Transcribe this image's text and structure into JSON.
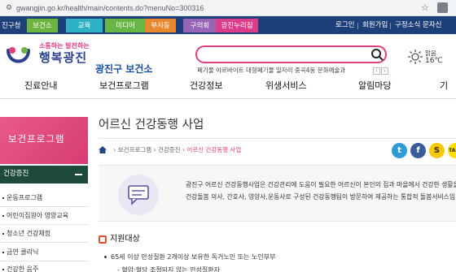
{
  "browser": {
    "url": "gwangjin.go.kr/health/main/contents.do?menuNo=300316"
  },
  "top_nav": {
    "items": [
      "진구청",
      "보건소",
      "교육",
      "미디어",
      "부사동",
      "구의회",
      "광진누리집"
    ],
    "right": [
      "로그인",
      "회원가입",
      "구정소식 문자신"
    ]
  },
  "header": {
    "slogan_top": "소통하는 발전하는",
    "slogan_bottom": "행복광진",
    "site_name": "광진구 보건소",
    "search_placeholder": "",
    "keywords": "폐기물  아르바이트  대형폐기물  일자리  중곡4동  문화예술과",
    "kw_prev": "‹",
    "kw_next": "›",
    "weather_label": "맑음",
    "weather_temp": "16℃"
  },
  "main_menu": [
    "진료안내",
    "보건프로그램",
    "건강정보",
    "위생서비스",
    "알림마당",
    "기"
  ],
  "sidebar": {
    "banner_title": "보건프로그램",
    "section_label": "건강증진",
    "items": [
      "운동프로그램",
      "어린이집원아 영양교육",
      "청소년 건강체험",
      "금연 클리닉",
      "건강한 음주"
    ]
  },
  "content": {
    "page_title": "어르신 건강동행 사업",
    "breadcrumb": {
      "items": [
        "보건프로그램",
        "건강증진"
      ],
      "separator": "›",
      "current": "어르신 건강동행 사업"
    },
    "social": {
      "tw": "t",
      "fb": "f",
      "ks": "S",
      "kt": "TALK"
    },
    "intro_lines": [
      "광진구 어르신 건강동행사업은 건강관리에 도움이 필요한 어르신이 본인의 집과 마을에서 건강한 생활을",
      "건강돌봄 의사, 간호사, 영양사,운동사로 구성된 건강동행팀이 방문하여 제공하는 통합적 돌봄서비스입"
    ],
    "section_title": "지원대상",
    "lines": [
      "65세 이상 만성질환 2개이상 보유한 독거노인 또는 노인부부",
      "- 혈압·혈당 조절되지 않는 만성질환자"
    ]
  },
  "colors": {
    "top_nav_bg": "#1d3f7a",
    "accent_pink": "#e0407f",
    "sidebar_head": "#1d4a3b"
  }
}
